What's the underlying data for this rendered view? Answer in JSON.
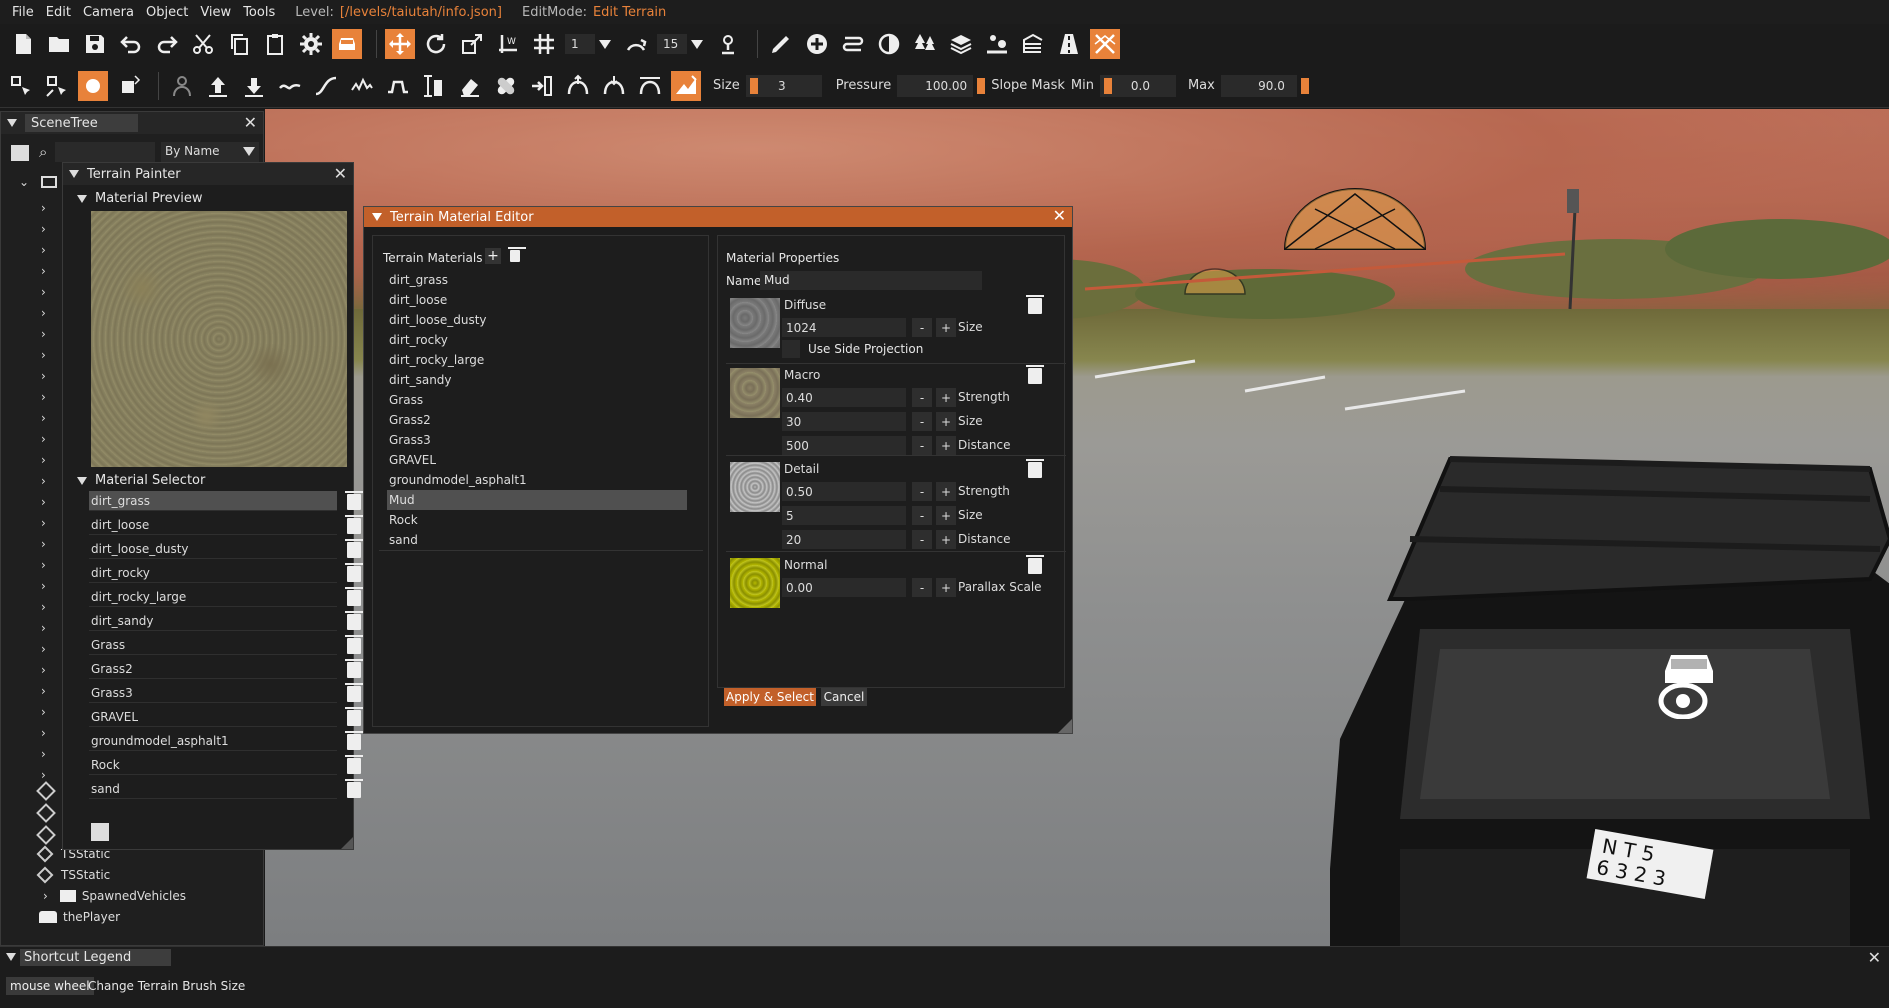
{
  "menubar": {
    "items": [
      "File",
      "Edit",
      "Camera",
      "Object",
      "View",
      "Tools"
    ],
    "level_label": "Level:",
    "level_value": "[/levels/taiutah/info.json]",
    "editmode_label": "EditMode:",
    "editmode_value": "Edit Terrain"
  },
  "toolbar1": {
    "snap_value": "1",
    "rotate_value": "15"
  },
  "toolbar2": {
    "size_label": "Size",
    "size_value": "3",
    "pressure_label": "Pressure",
    "pressure_value": "100.00",
    "slope_mask_label": "Slope Mask",
    "min_label": "Min",
    "min_value": "0.0",
    "max_label": "Max",
    "max_value": "90.0"
  },
  "scene_tree": {
    "title": "SceneTree",
    "filter_mode": "By Name",
    "items": [
      {
        "label": "TSStatic"
      },
      {
        "label": "TSStatic"
      },
      {
        "label": "SpawnedVehicles"
      },
      {
        "label": "thePlayer"
      }
    ]
  },
  "terrain_painter": {
    "title": "Terrain Painter",
    "preview_section": "Material Preview",
    "selector_section": "Material Selector",
    "materials": [
      "dirt_grass",
      "dirt_loose",
      "dirt_loose_dusty",
      "dirt_rocky",
      "dirt_rocky_large",
      "dirt_sandy",
      "Grass",
      "Grass2",
      "Grass3",
      "GRAVEL",
      "groundmodel_asphalt1",
      "Rock",
      "sand"
    ],
    "selected_index": 0
  },
  "material_editor": {
    "title": "Terrain Material Editor",
    "list_header": "Terrain Materials",
    "materials": [
      "dirt_grass",
      "dirt_loose",
      "dirt_loose_dusty",
      "dirt_rocky",
      "dirt_rocky_large",
      "dirt_sandy",
      "Grass",
      "Grass2",
      "Grass3",
      "GRAVEL",
      "groundmodel_asphalt1",
      "Mud",
      "Rock",
      "sand"
    ],
    "selected_index": 11,
    "properties_header": "Material Properties",
    "name_label": "Name",
    "name_value": "Mud",
    "diffuse": {
      "title": "Diffuse",
      "size": "1024",
      "size_label": "Size",
      "side_projection_label": "Use Side Projection"
    },
    "macro": {
      "title": "Macro",
      "strength": "0.40",
      "strength_label": "Strength",
      "size": "30",
      "size_label": "Size",
      "distance": "500",
      "distance_label": "Distance"
    },
    "detail": {
      "title": "Detail",
      "strength": "0.50",
      "strength_label": "Strength",
      "size": "5",
      "size_label": "Size",
      "distance": "20",
      "distance_label": "Distance"
    },
    "normal": {
      "title": "Normal",
      "parallax": "0.00",
      "parallax_label": "Parallax Scale"
    },
    "minus": "-",
    "plus": "+",
    "apply_label": "Apply & Select",
    "cancel_label": "Cancel"
  },
  "shortcut_legend": {
    "title": "Shortcut Legend",
    "key": "mouse wheel",
    "action": "Change Terrain Brush Size"
  },
  "plate": {
    "line1": "N T 5",
    "line2": "6 3 2 3"
  },
  "colors": {
    "accent": "#e8823a",
    "title_orange": "#c2602a",
    "panel": "#1f1f1f"
  }
}
